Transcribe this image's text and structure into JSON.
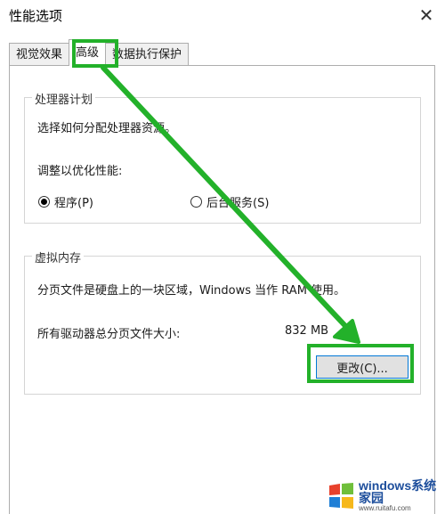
{
  "window": {
    "title": "性能选项"
  },
  "tabs": [
    {
      "label": "视觉效果",
      "active": false
    },
    {
      "label": "高级",
      "active": true
    },
    {
      "label": "数据执行保护",
      "active": false
    }
  ],
  "processor": {
    "legend": "处理器计划",
    "description": "选择如何分配处理器资源。",
    "adjust_label": "调整以优化性能:",
    "options": [
      {
        "label": "程序(P)",
        "selected": true
      },
      {
        "label": "后台服务(S)",
        "selected": false
      }
    ]
  },
  "virtual_memory": {
    "legend": "虚拟内存",
    "description": "分页文件是硬盘上的一块区域，Windows 当作 RAM 使用。",
    "total_label": "所有驱动器总分页文件大小:",
    "total_value": "832 MB",
    "change_button": "更改(C)..."
  },
  "watermark": {
    "brand": "windows系统家园",
    "url": "www.ruitafu.com"
  },
  "colors": {
    "highlight": "#23b12a",
    "button_border": "#0078d7"
  }
}
